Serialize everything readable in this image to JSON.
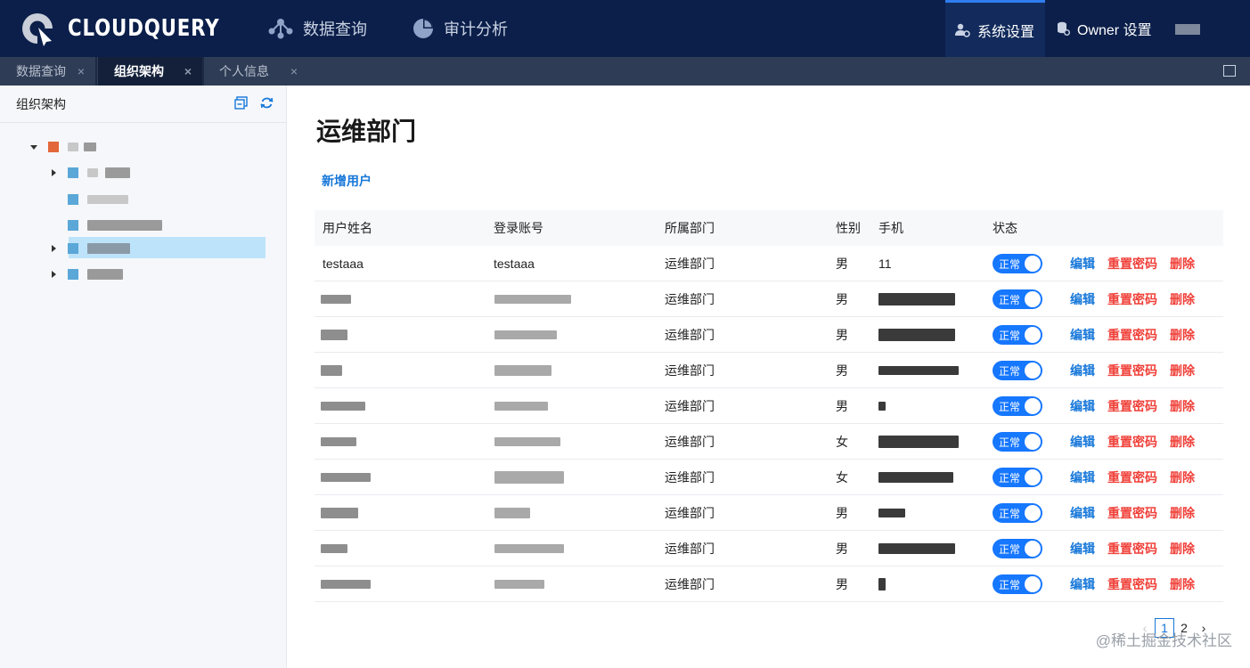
{
  "brand": {
    "name": "CLOUDQUERY"
  },
  "topnav": {
    "query": {
      "label": "数据查询",
      "icon": "share-nodes-icon"
    },
    "audit": {
      "label": "审计分析",
      "icon": "pie-chart-icon"
    },
    "settings": {
      "label": "系统设置",
      "icon": "user-gear-icon"
    },
    "owner": {
      "label": "Owner 设置",
      "icon": "database-gear-icon"
    }
  },
  "tabs": [
    {
      "label": "数据查询",
      "close": "×"
    },
    {
      "label": "组织架构",
      "close": "×"
    },
    {
      "label": "个人信息",
      "close": "×"
    }
  ],
  "sidebar": {
    "title": "组织架构"
  },
  "main": {
    "title": "运维部门",
    "add_user": "新增用户",
    "columns": {
      "name": "用户姓名",
      "account": "登录账号",
      "dept": "所属部门",
      "gender": "性别",
      "phone": "手机",
      "status": "状态"
    },
    "rows": [
      {
        "name": "testaaa",
        "account": "testaaa",
        "dept": "运维部门",
        "gender": "男",
        "phone": "11",
        "status": "正常"
      },
      {
        "name": "",
        "account": "",
        "dept": "运维部门",
        "gender": "男",
        "phone": "",
        "status": "正常"
      },
      {
        "name": "",
        "account": "",
        "dept": "运维部门",
        "gender": "男",
        "phone": "",
        "status": "正常"
      },
      {
        "name": "",
        "account": "",
        "dept": "运维部门",
        "gender": "男",
        "phone": "",
        "status": "正常"
      },
      {
        "name": "",
        "account": "",
        "dept": "运维部门",
        "gender": "男",
        "phone": "",
        "status": "正常"
      },
      {
        "name": "",
        "account": "",
        "dept": "运维部门",
        "gender": "女",
        "phone": "",
        "status": "正常"
      },
      {
        "name": "",
        "account": "",
        "dept": "运维部门",
        "gender": "女",
        "phone": "",
        "status": "正常"
      },
      {
        "name": "",
        "account": "",
        "dept": "运维部门",
        "gender": "男",
        "phone": "",
        "status": "正常"
      },
      {
        "name": "",
        "account": "",
        "dept": "运维部门",
        "gender": "男",
        "phone": "",
        "status": "正常"
      },
      {
        "name": "",
        "account": "",
        "dept": "运维部门",
        "gender": "男",
        "phone": "",
        "status": "正常"
      }
    ],
    "actions": {
      "edit": "编辑",
      "reset": "重置密码",
      "delete": "删除"
    },
    "pagination": {
      "prev": "‹",
      "pages": [
        "1",
        "2"
      ],
      "current": "1",
      "next": "›"
    }
  },
  "watermark": "@稀土掘金技术社区",
  "colors": {
    "topbar": "#0b1f4a",
    "accent": "#1677ff",
    "danger": "#f0413a",
    "selected_tree": "#bde3fb"
  }
}
